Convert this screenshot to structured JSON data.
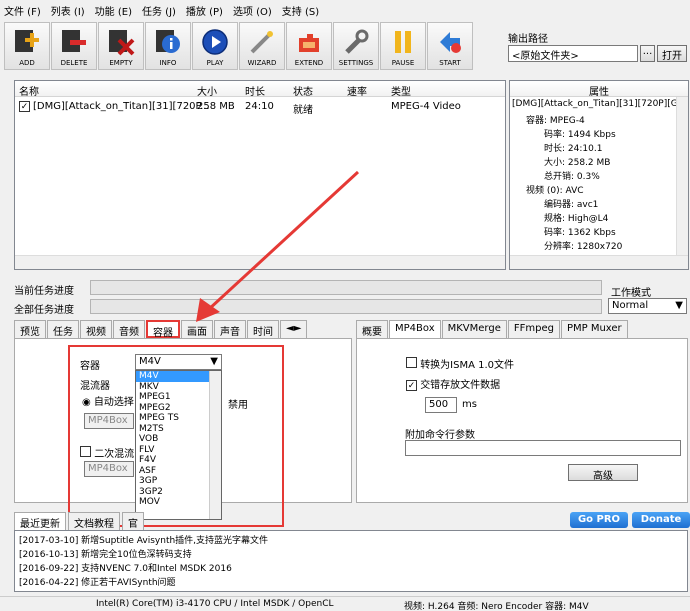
{
  "menu": [
    "文件 (F)",
    "列表 (I)",
    "功能 (E)",
    "任务 (J)",
    "播放 (P)",
    "选项 (O)",
    "支持 (S)"
  ],
  "toolbar": [
    {
      "label": "ADD",
      "icon": "add-icon",
      "color": "#e8a317"
    },
    {
      "label": "DELETE",
      "icon": "delete-icon",
      "color": "#d92b2b"
    },
    {
      "label": "EMPTY",
      "icon": "empty-icon",
      "color": "#8b1a1a"
    },
    {
      "label": "INFO",
      "icon": "info-icon",
      "color": "#2a6bd1"
    },
    {
      "label": "PLAY",
      "icon": "play-icon",
      "color": "#1d4fb8"
    },
    {
      "label": "WIZARD",
      "icon": "wizard-icon",
      "color": "#9a9a9a"
    },
    {
      "label": "EXTEND",
      "icon": "extend-icon",
      "color": "#e2402b"
    },
    {
      "label": "SETTINGS",
      "icon": "settings-icon",
      "color": "#7a7a7a"
    },
    {
      "label": "PAUSE",
      "icon": "pause-icon",
      "color": "#f1b51c"
    },
    {
      "label": "START",
      "icon": "start-icon",
      "color": "#2e7bd6"
    }
  ],
  "output": {
    "label": "输出路径",
    "value": "<原始文件夹>",
    "browse": "...",
    "open": "打开"
  },
  "grid": {
    "headers": [
      "名称",
      "大小",
      "时长",
      "状态",
      "速率",
      "类型"
    ],
    "row": {
      "name": "[DMG][Attack_on_Titan][31][720P...",
      "size": "258 MB",
      "duration": "24:10",
      "status": "就绪",
      "rate": "",
      "type": "MPEG-4 Video"
    }
  },
  "properties": {
    "title": "属性",
    "lines": [
      "[DMG][Attack_on_Titan][31][720P][GB",
      "容器: MPEG-4",
      "码率: 1494 Kbps",
      "时长: 24:10.1",
      "大小: 258.2 MB",
      "总开销: 0.3%",
      "视频 (0): AVC",
      "编码器: avc1",
      "规格: High@L4",
      "码率: 1362 Kbps",
      "分辨率: 1280x720"
    ]
  },
  "progress": {
    "current": "当前任务进度",
    "total": "全部任务进度"
  },
  "workmode": {
    "label": "工作模式",
    "value": "Normal"
  },
  "left_tabs": [
    "预览",
    "任务",
    "视频",
    "音频",
    "容器",
    "画面",
    "声音",
    "时间"
  ],
  "left_panel": {
    "container_label": "容器",
    "container_value": "M4V",
    "muxer_group": "混流器",
    "auto_select": "自动选择",
    "disable": "禁用",
    "muxer_value": "MP4Box",
    "second_mux": "二次混流",
    "second_value": "MP4Box",
    "options": [
      "M4V",
      "MKV",
      "MPEG1",
      "MPEG2",
      "MPEG TS",
      "M2TS",
      "VOB",
      "FLV",
      "F4V",
      "ASF",
      "3GP",
      "3GP2",
      "MOV"
    ]
  },
  "right_tabs": [
    "概要",
    "MP4Box",
    "MKVMerge",
    "FFmpeg",
    "PMP Muxer"
  ],
  "right_panel": {
    "isma": "转换为ISMA 1.0文件",
    "interleave": "交错存放文件数据",
    "interleave_value": "500",
    "interleave_unit": "ms",
    "extra_label": "附加命令行参数",
    "advanced": "高级"
  },
  "news": {
    "tabs": [
      "最近更新",
      "文档教程",
      "官"
    ],
    "gopro": "Go PRO",
    "donate": "Donate",
    "items": [
      "[2017-03-10] 新增Suptitle Avisynth插件,支持蓝光字幕文件",
      "[2016-10-13] 新增完全10位色深转码支持",
      "[2016-09-22] 支持NVENC 7.0和Intel MSDK 2016",
      "[2016-04-22] 修正若干AVISynth问题"
    ]
  },
  "status": {
    "left": "Intel(R) Core(TM) i3-4170 CPU / Intel MSDK / OpenCL",
    "right": "视频: H.264 音频: Nero Encoder 容器: M4V"
  }
}
